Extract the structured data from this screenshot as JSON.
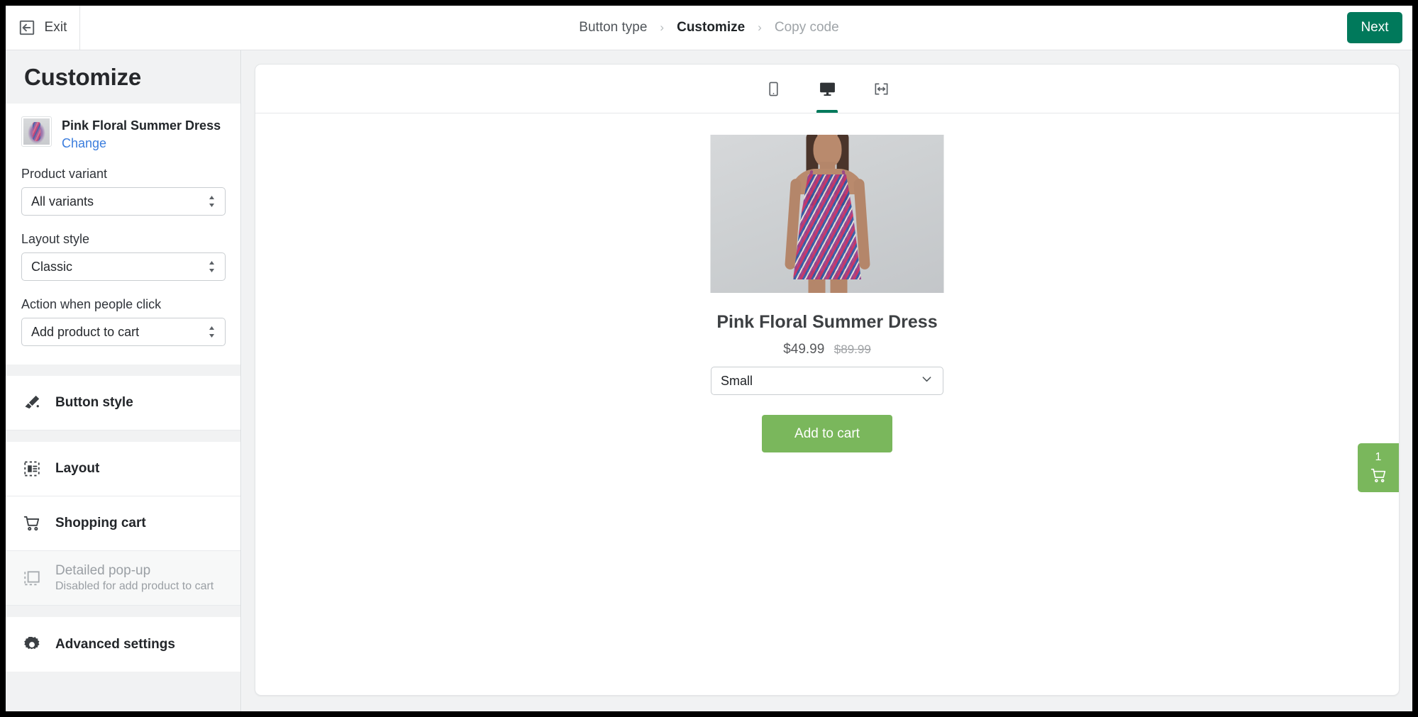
{
  "topbar": {
    "exit_label": "Exit",
    "exit_icon": "exit-arrow-icon",
    "next_label": "Next",
    "next_color": "#00795b",
    "breadcrumb": [
      {
        "label": "Button type",
        "state": "done"
      },
      {
        "label": "Customize",
        "state": "active"
      },
      {
        "label": "Copy code",
        "state": "muted"
      }
    ],
    "separator": "›"
  },
  "sidebar": {
    "title": "Customize",
    "product": {
      "name": "Pink Floral Summer Dress",
      "change_label": "Change",
      "thumbnail_icon": "product-thumbnail"
    },
    "fields": [
      {
        "label": "Product variant",
        "value": "All variants"
      },
      {
        "label": "Layout style",
        "value": "Classic"
      },
      {
        "label": "Action when people click",
        "value": "Add product to cart"
      }
    ],
    "menu": [
      {
        "label": "Button style",
        "icon": "paint-brush-icon",
        "disabled": false,
        "sub": ""
      },
      {
        "label": "Layout",
        "icon": "layout-icon",
        "disabled": false,
        "sub": ""
      },
      {
        "label": "Shopping cart",
        "icon": "shopping-cart-icon",
        "disabled": false,
        "sub": ""
      },
      {
        "label": "Detailed pop-up",
        "icon": "popup-icon",
        "disabled": true,
        "sub": "Disabled for add product to cart"
      },
      {
        "label": "Advanced settings",
        "icon": "gear-icon",
        "disabled": false,
        "sub": ""
      }
    ]
  },
  "preview": {
    "devices": [
      {
        "name": "mobile-view",
        "icon": "mobile-icon",
        "active": false
      },
      {
        "name": "desktop-view",
        "icon": "desktop-icon",
        "active": true
      },
      {
        "name": "fullwidth-view",
        "icon": "full-width-icon",
        "active": false
      }
    ],
    "active_indicator_color": "#00795b",
    "product": {
      "title": "Pink Floral Summer Dress",
      "price": "$49.99",
      "compare_at_price": "$89.99",
      "variant_value": "Small",
      "variant_icon": "chevron-down-icon",
      "add_to_cart_label": "Add to cart",
      "button_color": "#7ab75c",
      "image_icon": "product-photo"
    },
    "cart_tab": {
      "count": "1",
      "icon": "shopping-cart-icon",
      "color": "#7ab75c"
    }
  }
}
